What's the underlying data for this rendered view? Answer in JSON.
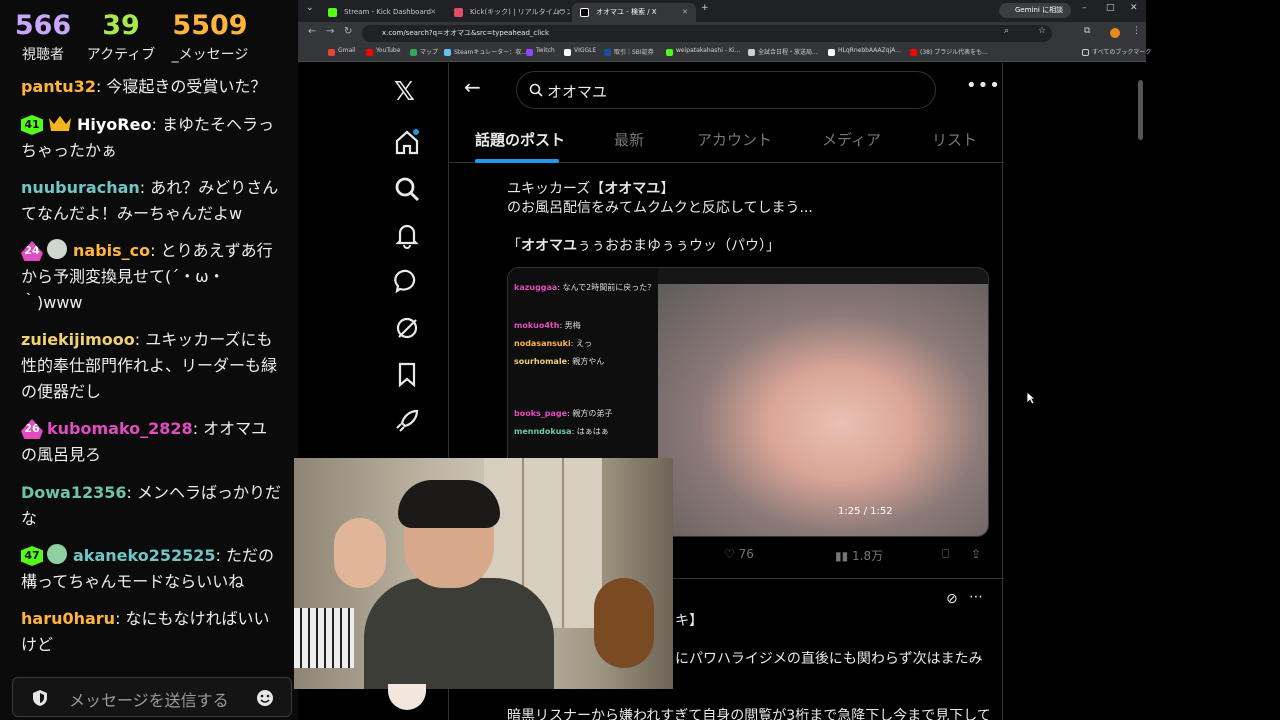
{
  "chat": {
    "stats": {
      "viewers": {
        "value": "566",
        "label": "視聴者"
      },
      "active": {
        "value": "39",
        "label": "アクティブ"
      },
      "messages": {
        "value": "5509",
        "label": "_メッセージ"
      }
    },
    "messages": [
      {
        "user": "pantu32",
        "text": ": 今寝起きの受賞いた？",
        "color": "#ffb43b"
      },
      {
        "user": "HiyoReo",
        "badge": "41",
        "text": ": まゆたそヘラっちゃったかぁ",
        "color": "#ffffff"
      },
      {
        "user": "nuuburachan",
        "text": ": あれ？みどりさんてなんだよ！みーちゃんだよw",
        "color": "#6ec6c6"
      },
      {
        "user": "nabis_co",
        "badge": "24",
        "text": ": とりあえずあ行から予測変換見せて(´・ω・｀)www",
        "color": "#ffb43b"
      },
      {
        "user": "zuiekijimooo",
        "text": ": ユキッカーズにも性的奉仕部門作れよ、リーダーも緑の便器だし",
        "color": "#f0d070"
      },
      {
        "user": "kubomako_2828",
        "badge": "26",
        "text": ": オオマユの風呂見ろ",
        "color": "#e24bc2"
      },
      {
        "user": "Dowa12356",
        "text": ": メンヘラばっかりだな",
        "color": "#6ec6a8"
      },
      {
        "user": "akaneko252525",
        "badge": "47",
        "text": ": ただの構ってちゃんモードならいいね",
        "color": "#6ec6c6"
      },
      {
        "user": "haru0haru",
        "text": ": なにもなければいいけど",
        "color": "#ffb43b"
      }
    ],
    "input_placeholder": "メッセージを送信する"
  },
  "browser": {
    "tabs": [
      {
        "title": "Stream - Kick Dashboard",
        "color": "#53fc18"
      },
      {
        "title": "Kick(キック) | リアルタイムランキング",
        "color": "#e24b6a"
      },
      {
        "title": "オオマユ - 検索 / X",
        "color": "#ffffff"
      }
    ],
    "gemini_label": "Gemini に相談",
    "url": "x.com/search?q=オオマユ&src=typeahead_click",
    "bookmarks": [
      {
        "label": "Gmail",
        "color": "#ea4335"
      },
      {
        "label": "YouTube",
        "color": "#ff0000"
      },
      {
        "label": "マップ",
        "color": "#34a853"
      },
      {
        "label": "Steamキュレーター：収...",
        "color": "#66c0f4"
      },
      {
        "label": "Twitch",
        "color": "#9146ff"
      },
      {
        "label": "VIGGLE",
        "color": "#ffffff"
      },
      {
        "label": "取引｜SBI証券",
        "color": "#1a4fa0"
      },
      {
        "label": "weipatakahashi - Ki...",
        "color": "#53fc18"
      },
      {
        "label": "全試合日程・放送局...",
        "color": "#d0d0d0"
      },
      {
        "label": "HLqRnebbAAAZqjA...",
        "color": "#ffffff"
      },
      {
        "label": "(38) ブラジル代表をも...",
        "color": "#ff0000"
      }
    ],
    "all_bookmarks": "すべてのブックマーク"
  },
  "x": {
    "search_query": "オオマユ",
    "tabs": [
      "話題のポスト",
      "最新",
      "アカウント",
      "メディア",
      "リスト"
    ],
    "post": {
      "line1_prefix": "ユキッカーズ【",
      "line1_bold": "オオマユ",
      "line1_suffix": "】",
      "line2": "のお風呂配信をみてムクムクと反応してしまう...",
      "line3_prefix": "「",
      "line3_bold": "オオマユ",
      "line3_suffix": "ぅぅおおまゆぅぅウッ（パウ）」",
      "likes": "76",
      "views": "1.8万",
      "video_time": "1:25 / 1:52",
      "video_chat": [
        {
          "user": "kazuggaa",
          "text": ": なんで2時間前に戻った？"
        },
        {
          "user": "mokuo4th",
          "text": ": 男梅"
        },
        {
          "user": "nodasansuki",
          "text": ": えっ"
        },
        {
          "user": "sourhomale",
          "text": ": 親方やん"
        },
        {
          "user": "books_page",
          "text": ": 親方の弟子"
        },
        {
          "user": "menndokusa",
          "text": ": はぁはぁ"
        }
      ]
    },
    "post2": {
      "line1": "キ】",
      "line2": "にパワハライジメの直後にも関わらず次はまたみ",
      "line3": "暗黒リスナーから嫌われすぎて自身の閲覧が3桁まで急降下し今まで見下して"
    }
  }
}
